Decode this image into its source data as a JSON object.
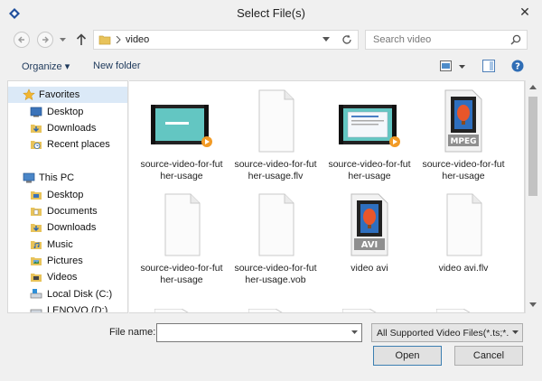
{
  "window": {
    "title": "Select File(s)"
  },
  "navigation": {
    "path_segment": "video",
    "search_placeholder": "Search video"
  },
  "toolbar": {
    "organize_label": "Organize ▾",
    "new_folder_label": "New folder"
  },
  "sidebar": {
    "favorites_label": "Favorites",
    "favorites_items": [
      "Desktop",
      "Downloads",
      "Recent places"
    ],
    "this_pc_label": "This PC",
    "pc_items": [
      "Desktop",
      "Documents",
      "Downloads",
      "Music",
      "Pictures",
      "Videos",
      "Local Disk (C:)",
      "LENOVO (D:)"
    ]
  },
  "files": [
    {
      "name": "source-video-for-futher-usage",
      "icon": "video-thumbnail"
    },
    {
      "name": "source-video-for-futher-usage.flv",
      "icon": "blank-file"
    },
    {
      "name": "source-video-for-futher-usage",
      "icon": "video-thumbnail"
    },
    {
      "name": "source-video-for-futher-usage",
      "icon": "mpeg-file"
    },
    {
      "name": "source-video-for-futher-usage",
      "icon": "blank-file"
    },
    {
      "name": "source-video-for-futher-usage.vob",
      "icon": "blank-file"
    },
    {
      "name": "video avi",
      "icon": "avi-file"
    },
    {
      "name": "video avi.flv",
      "icon": "blank-file"
    }
  ],
  "bottom": {
    "file_name_label": "File name:",
    "file_name_value": "",
    "filter_value": "All Supported Video Files(*.ts;*.",
    "open_label": "Open",
    "cancel_label": "Cancel"
  },
  "colors": {
    "accent": "#3c7fb1",
    "selection": "#dbe9f7",
    "folder": "#e8c35a"
  }
}
